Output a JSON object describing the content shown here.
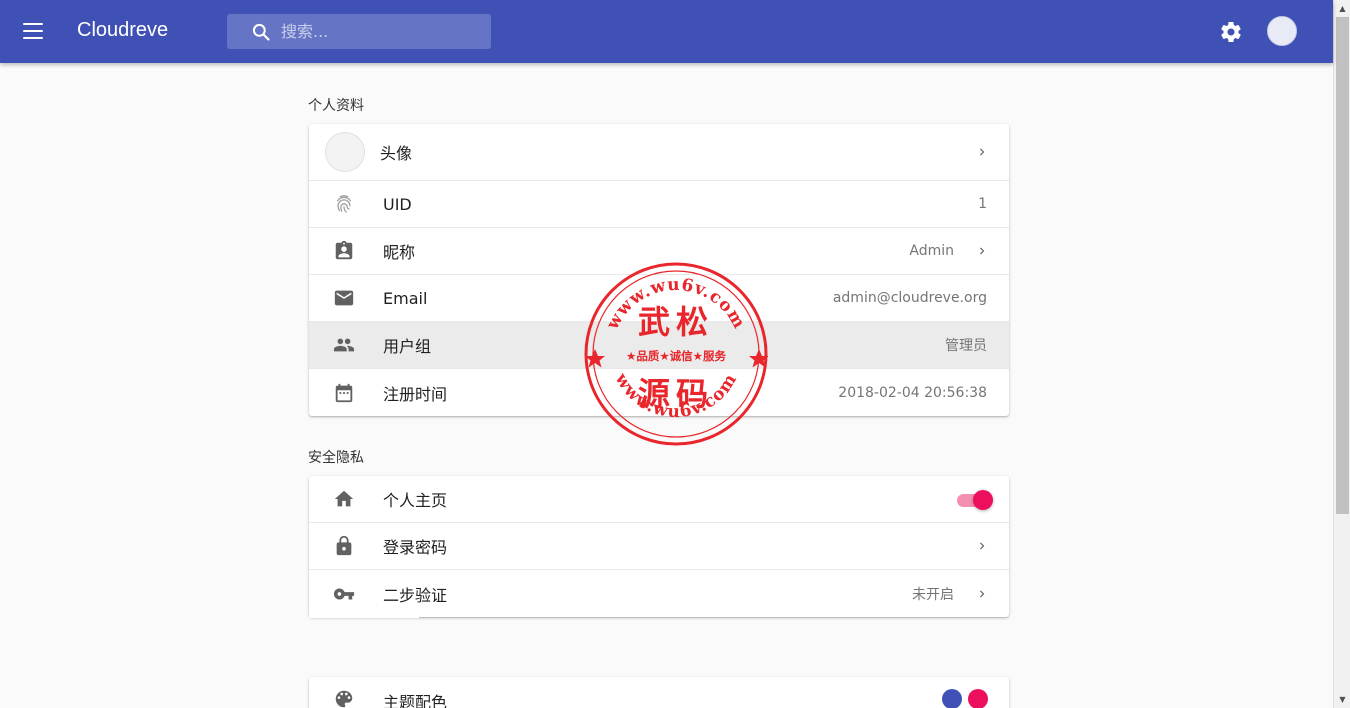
{
  "app": {
    "title": "Cloudreve"
  },
  "search": {
    "placeholder": "搜索..."
  },
  "sections": {
    "profile": "个人资料",
    "security": "安全隐私"
  },
  "profile_rows": {
    "avatar": {
      "label": "头像"
    },
    "uid": {
      "label": "UID",
      "value": "1"
    },
    "nickname": {
      "label": "昵称",
      "value": "Admin"
    },
    "email": {
      "label": "Email",
      "value": "admin@cloudreve.org"
    },
    "group": {
      "label": "用户组",
      "value": "管理员"
    },
    "registered": {
      "label": "注册时间",
      "value": "2018-02-04 20:56:38"
    }
  },
  "security_rows": {
    "homepage": {
      "label": "个人主页",
      "enabled": true
    },
    "password": {
      "label": "登录密码"
    },
    "twofa": {
      "label": "二步验证",
      "value": "未开启"
    }
  },
  "theme_rows": {
    "theme": {
      "label": "主题配色",
      "primary": "#3f51b5",
      "secondary": "#ec0f5e"
    }
  },
  "colors": {
    "appbar": "#3f51b5",
    "accent": "#ec0f5e",
    "stamp": "#e8262b"
  },
  "icons": [
    "menu-icon",
    "search-icon",
    "gear-icon",
    "fingerprint-icon",
    "contact-card-icon",
    "email-icon",
    "group-icon",
    "calendar-icon",
    "home-icon",
    "lock-icon",
    "key-icon",
    "palette-icon",
    "chevron-right-icon"
  ],
  "watermark": {
    "top_text": "www.wu6v.com",
    "main_top": "武松",
    "middle": "★品质★诚信★服务",
    "main_bottom": "源码",
    "bottom_text": "www.wu6v.com"
  }
}
